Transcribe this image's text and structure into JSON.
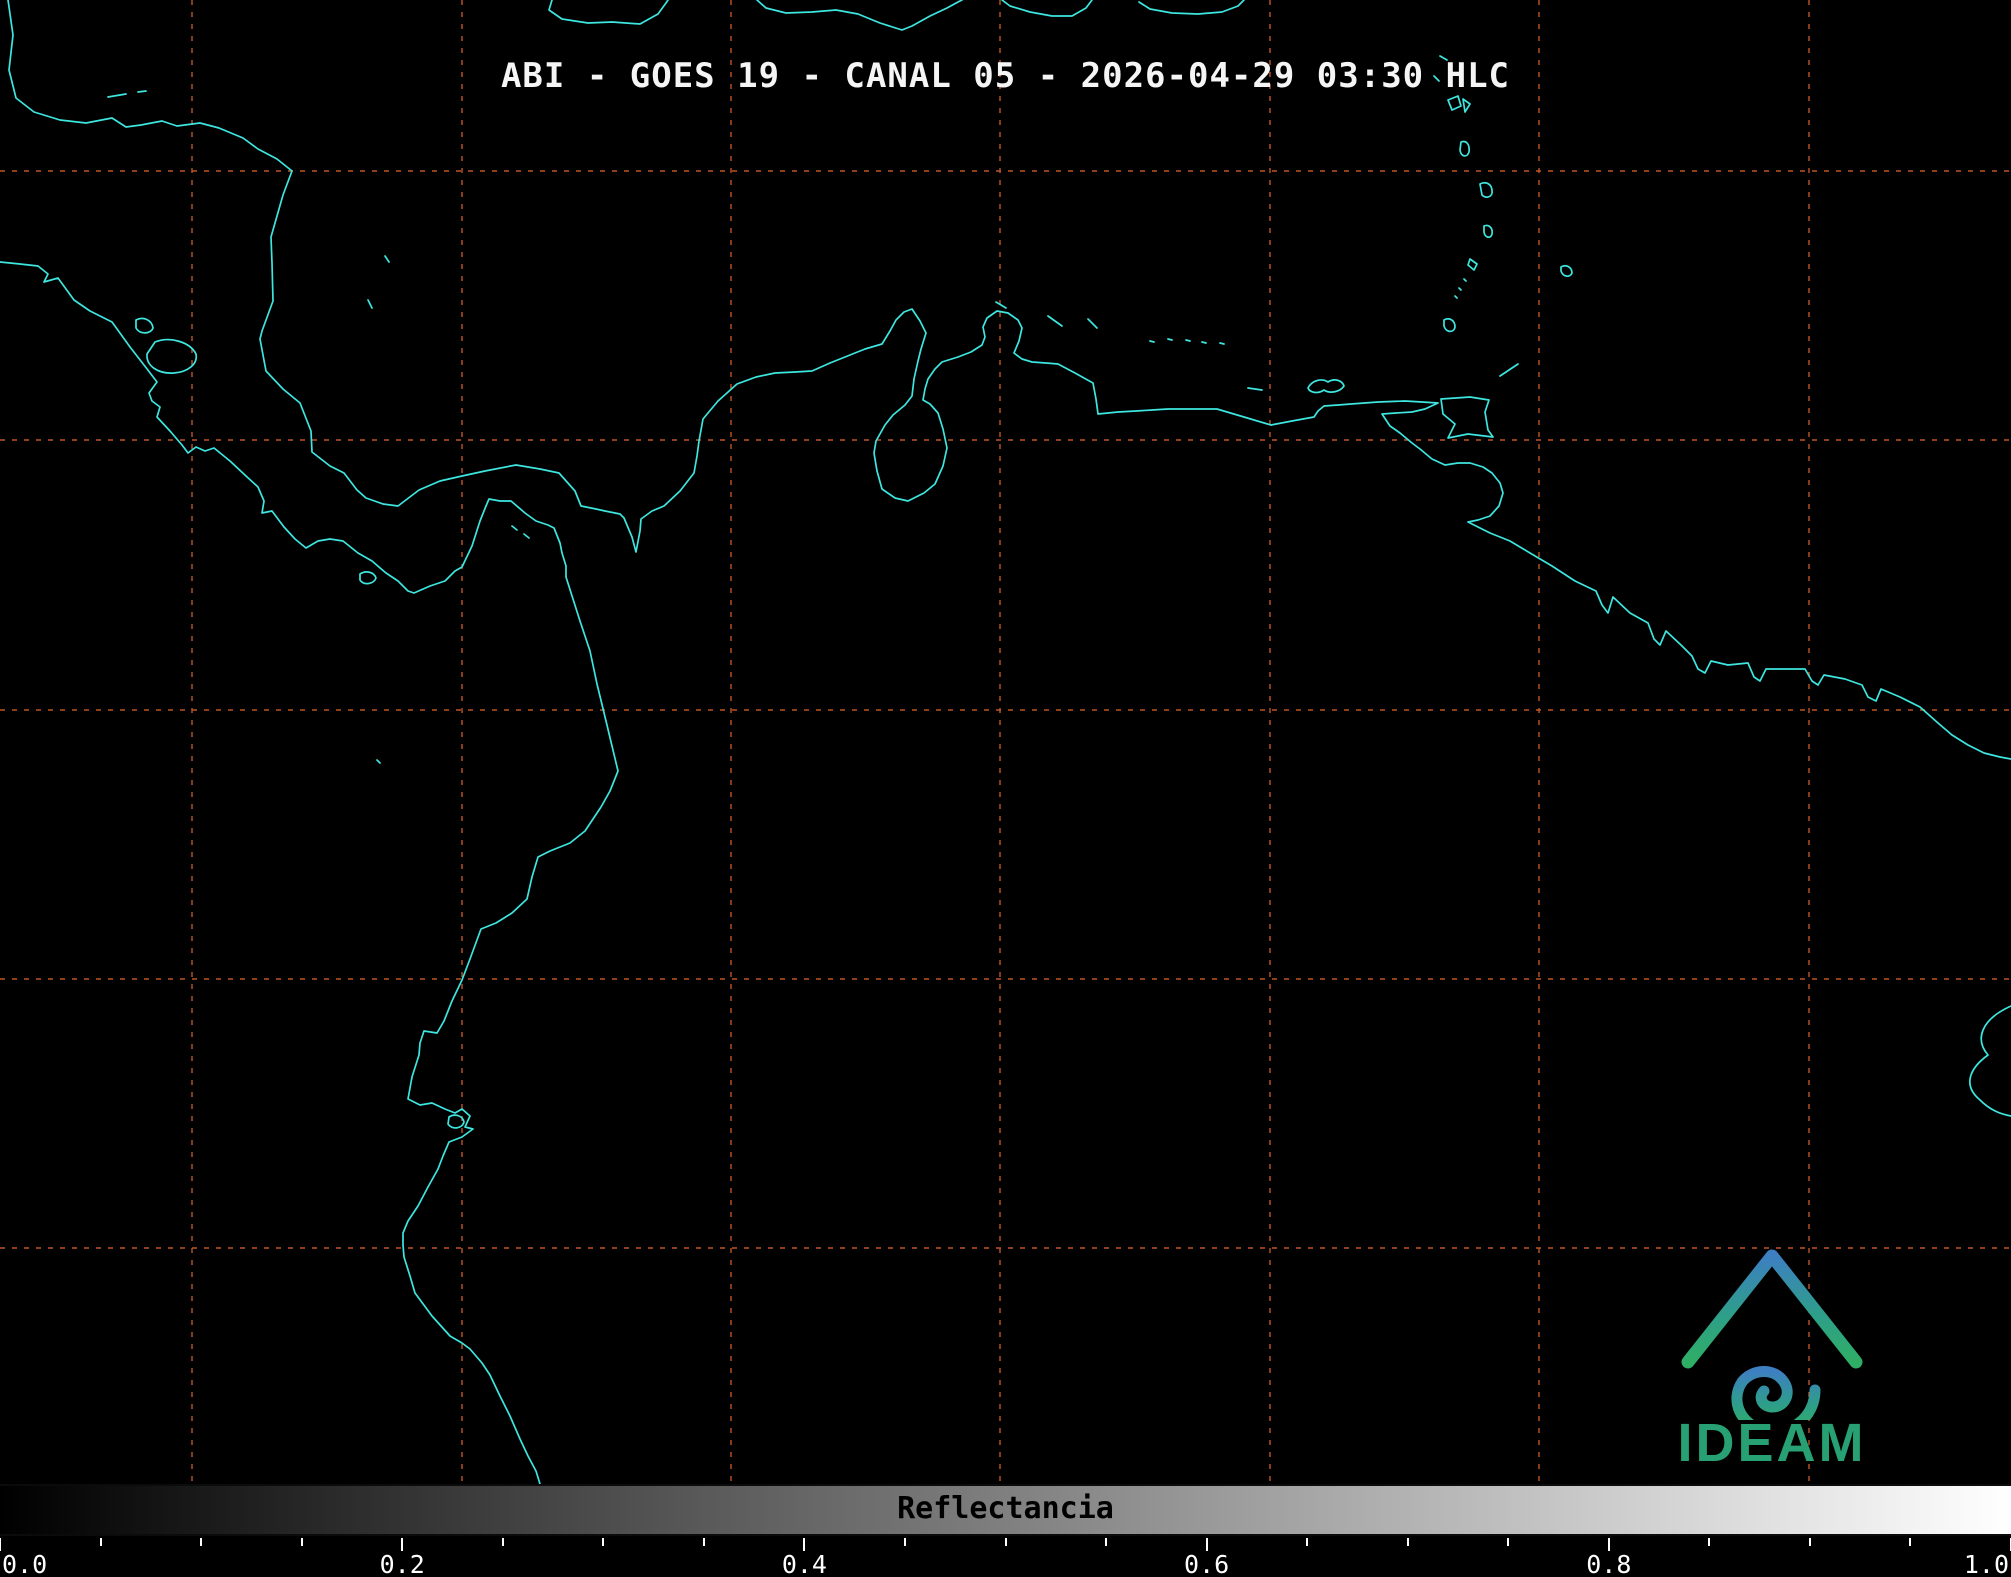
{
  "product": {
    "title": "ABI - GOES 19 - CANAL 05 - 2026-04-29 03:30 HLC"
  },
  "colorbar": {
    "label": "Reflectancia",
    "tick_labels": [
      "0.0",
      "0.2",
      "0.4",
      "0.6",
      "0.8",
      "1.0"
    ],
    "min": 0.0,
    "max": 1.0,
    "gradient": [
      "#000000",
      "#ffffff"
    ]
  },
  "branding": {
    "logo_text": "IDEAM"
  },
  "colors": {
    "background": "#000000",
    "coastline": "#3de6df",
    "graticule": "#c75b28",
    "title_text": "#f5f5f5",
    "tick_text": "#ffffff",
    "colorbar_label_text": "#000000",
    "logo_blue": "#3d7fc1",
    "logo_teal": "#2e9e8a",
    "logo_green": "#2fae66",
    "logo_text_color": "#27a074"
  }
}
